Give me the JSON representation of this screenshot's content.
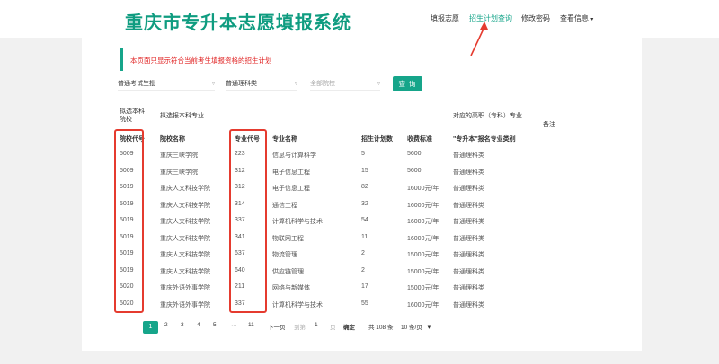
{
  "header": {
    "logo": "重庆市专升本志愿填报系统",
    "nav": [
      "填报志愿",
      "招生计划查询",
      "修改密码",
      "查看信息"
    ],
    "nav_caret": "▾"
  },
  "notice": "本页面只显示符合当前考生填报资格的招生计划",
  "filters": {
    "batch": "普通考试生批",
    "category": "普通理科类",
    "college_placeholder": "全部院校",
    "query_button": "查 询",
    "caret": "▿"
  },
  "table": {
    "group_headers": {
      "target_college": "拟选本科\n院校",
      "target_major": "拟选报本科专业",
      "vocational_major": "对应的高职（专科）专业",
      "remarks": "备注"
    },
    "columns": [
      "院校代号",
      "院校名称",
      "专业代号",
      "专业名称",
      "招生计划数",
      "收费标准",
      "\"专升本\"报名专业类别"
    ],
    "rows": [
      [
        "5009",
        "重庆三峡学院",
        "223",
        "信息与计算科学",
        "5",
        "5600",
        "普通理科类"
      ],
      [
        "5009",
        "重庆三峡学院",
        "312",
        "电子信息工程",
        "15",
        "5600",
        "普通理科类"
      ],
      [
        "5019",
        "重庆人文科技学院",
        "312",
        "电子信息工程",
        "82",
        "16000元/年",
        "普通理科类"
      ],
      [
        "5019",
        "重庆人文科技学院",
        "314",
        "通信工程",
        "32",
        "16000元/年",
        "普通理科类"
      ],
      [
        "5019",
        "重庆人文科技学院",
        "337",
        "计算机科学与技术",
        "54",
        "16000元/年",
        "普通理科类"
      ],
      [
        "5019",
        "重庆人文科技学院",
        "341",
        "物联网工程",
        "11",
        "16000元/年",
        "普通理科类"
      ],
      [
        "5019",
        "重庆人文科技学院",
        "637",
        "物流管理",
        "2",
        "15000元/年",
        "普通理科类"
      ],
      [
        "5019",
        "重庆人文科技学院",
        "640",
        "供应链管理",
        "2",
        "15000元/年",
        "普通理科类"
      ],
      [
        "5020",
        "重庆外语外事学院",
        "211",
        "网络与新媒体",
        "17",
        "15000元/年",
        "普通理科类"
      ],
      [
        "5020",
        "重庆外语外事学院",
        "337",
        "计算机科学与技术",
        "55",
        "16000元/年",
        "普通理科类"
      ]
    ]
  },
  "pagination": {
    "pages": [
      "1",
      "2",
      "3",
      "4",
      "5",
      "…",
      "11"
    ],
    "next": "下一页",
    "goto_label": "到第",
    "goto_value": "1",
    "page_unit": "页",
    "confirm": "确定",
    "total": "共 108 条",
    "page_size": "10 条/页",
    "page_size_caret": "▾"
  },
  "colors": {
    "brand": "#16a58a",
    "notice_text": "#e02020",
    "highlight_box": "#e53b2f"
  }
}
